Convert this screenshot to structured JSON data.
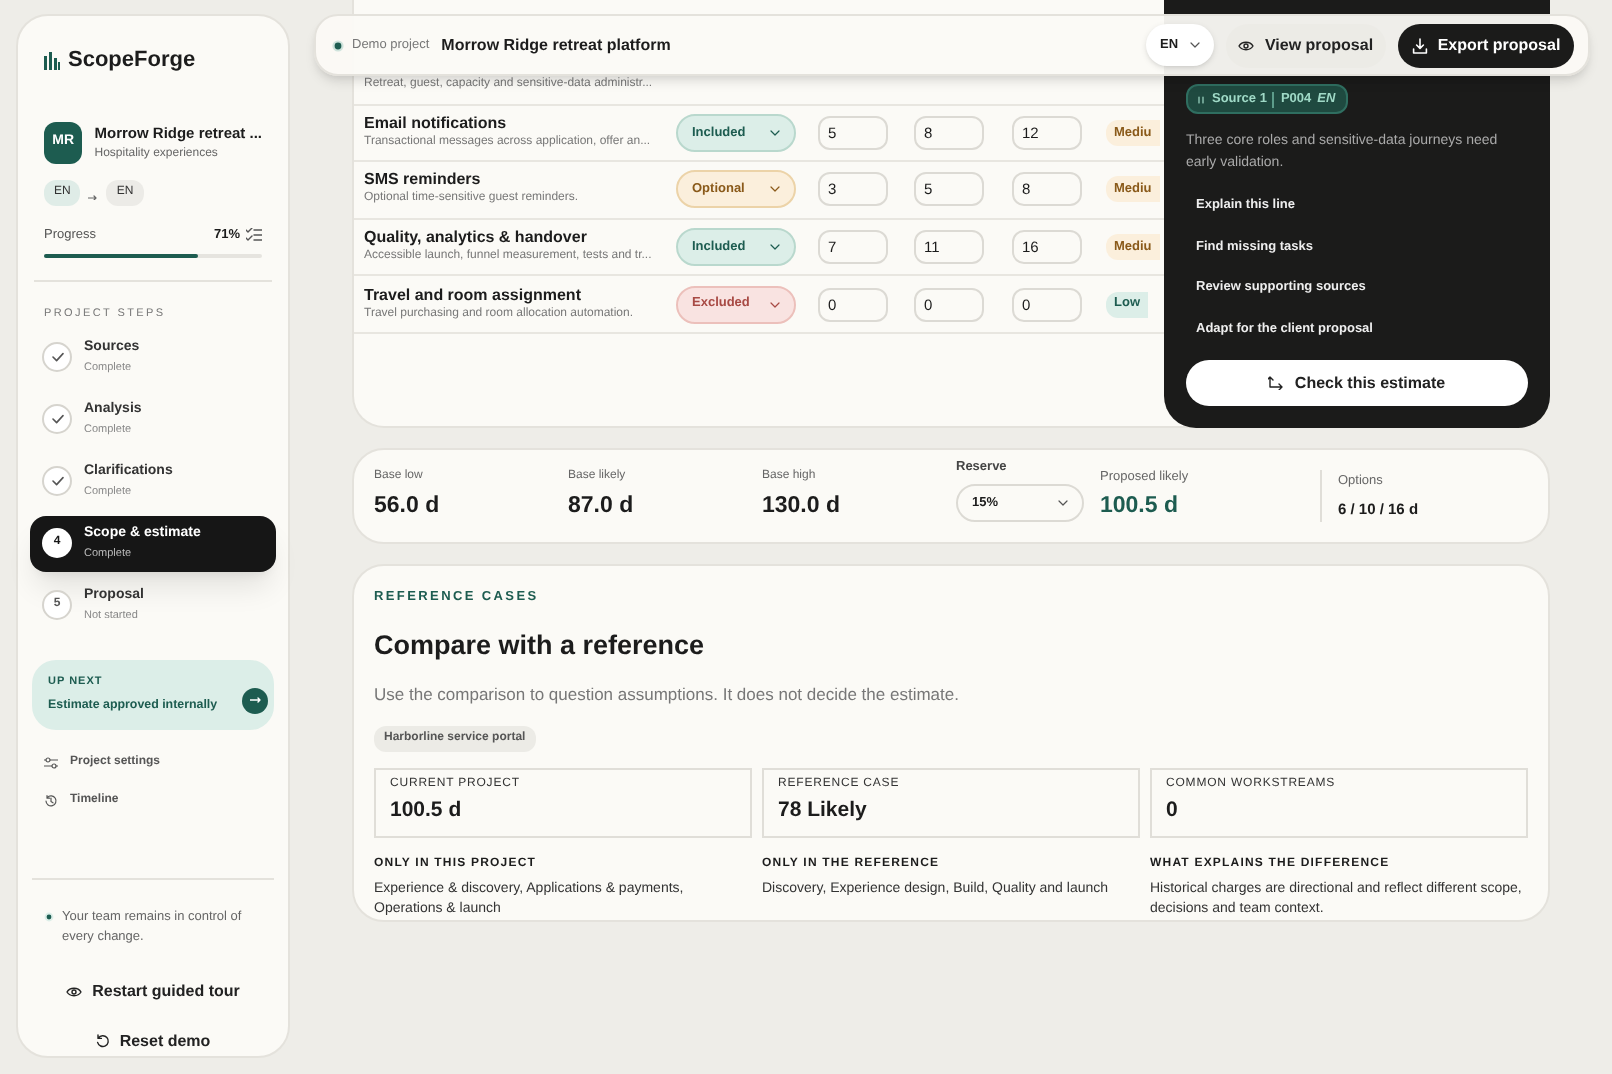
{
  "sidebar": {
    "brand": "ScopeForge",
    "project": {
      "initials": "MR",
      "name": "Morrow Ridge retreat ...",
      "subtitle": "Hospitality experiences"
    },
    "languages": {
      "source": "EN",
      "target": "EN"
    },
    "progress": {
      "label": "Progress",
      "value": "71%",
      "level": 0.71
    },
    "steps_heading": "PROJECT STEPS",
    "steps": [
      {
        "kind": "done",
        "title": "Sources",
        "status": "Complete",
        "selected": false
      },
      {
        "kind": "done",
        "title": "Analysis",
        "status": "Complete",
        "selected": false
      },
      {
        "kind": "done",
        "title": "Clarifications",
        "status": "Complete",
        "selected": false
      },
      {
        "kind": "numbered",
        "number": "4",
        "title": "Scope & estimate",
        "status": "Complete",
        "selected": true
      },
      {
        "kind": "numbered",
        "number": "5",
        "title": "Proposal",
        "status": "Not started",
        "selected": false
      }
    ],
    "up_next": {
      "label": "UP NEXT",
      "title": "Estimate approved internally"
    },
    "links": [
      {
        "kind": "settings",
        "label": "Project settings"
      },
      {
        "kind": "history",
        "label": "Timeline"
      }
    ],
    "note": "Your team remains in control of every change.",
    "buttons": [
      {
        "kind": "tour",
        "label": "Restart guided tour"
      },
      {
        "kind": "reset",
        "label": "Reset demo"
      }
    ]
  },
  "header": {
    "badge": "Demo project",
    "title": "Morrow Ridge retreat platform",
    "language": "EN",
    "buttons": [
      {
        "kind": "secondary",
        "label": "View proposal"
      },
      {
        "kind": "primary",
        "label": "Export proposal"
      }
    ]
  },
  "table": {
    "rows": [
      {
        "description": "Retreat, guest, capacity and sensitive-data administr..."
      },
      {
        "name": "Email notifications",
        "description": "Transactional messages across application, offer an...",
        "status": {
          "label": "Included",
          "kind": "included"
        },
        "low": "5",
        "likely": "8",
        "high": "12",
        "risk": {
          "label": "Mediu",
          "kind": "medium"
        }
      },
      {
        "name": "SMS reminders",
        "description": "Optional time-sensitive guest reminders.",
        "status": {
          "label": "Optional",
          "kind": "optional"
        },
        "low": "3",
        "likely": "5",
        "high": "8",
        "risk": {
          "label": "Mediu",
          "kind": "medium"
        }
      },
      {
        "name": "Quality, analytics & handover",
        "description": "Accessible launch, funnel measurement, tests and tr...",
        "status": {
          "label": "Included",
          "kind": "included"
        },
        "low": "7",
        "likely": "11",
        "high": "16",
        "risk": {
          "label": "Mediu",
          "kind": "medium"
        }
      },
      {
        "name": "Travel and room assignment",
        "description": "Travel purchasing and room allocation automation.",
        "status": {
          "label": "Excluded",
          "kind": "excluded"
        },
        "low": "0",
        "likely": "0",
        "high": "0",
        "risk": {
          "label": "Low",
          "kind": "low"
        }
      }
    ]
  },
  "assistant": {
    "source_chip": {
      "label": "Source 1",
      "ref": "P004",
      "lang": "EN"
    },
    "text": "Three core roles and sensitive-data journeys need early validation.",
    "actions": [
      "Explain this line",
      "Find missing tasks",
      "Review supporting sources",
      "Adapt for the client proposal"
    ],
    "button": "Check this estimate"
  },
  "summary": {
    "metrics": [
      {
        "label": "Base low",
        "value": "56.0 d"
      },
      {
        "label": "Base likely",
        "value": "87.0 d"
      },
      {
        "label": "Base high",
        "value": "130.0 d"
      }
    ],
    "reserve": {
      "label": "Reserve",
      "value": "15%"
    },
    "proposed": {
      "label": "Proposed likely",
      "value": "100.5 d"
    },
    "options": {
      "label": "Options",
      "value": "6 / 10 / 16 d"
    }
  },
  "reference": {
    "eyebrow": "REFERENCE CASES",
    "title": "Compare with a reference",
    "text": "Use the comparison to question assumptions. It does not decide the estimate.",
    "tag": "Harborline service portal",
    "stats": [
      {
        "label": "CURRENT PROJECT",
        "value": "100.5 d"
      },
      {
        "label": "REFERENCE CASE",
        "value": "78 Likely"
      },
      {
        "label": "COMMON WORKSTREAMS",
        "value": "0"
      }
    ],
    "columns": [
      {
        "heading": "ONLY IN THIS PROJECT",
        "text": "Experience & discovery, Applications & payments, Operations & launch"
      },
      {
        "heading": "ONLY IN THE REFERENCE",
        "text": "Discovery, Experience design, Build, Quality and launch"
      },
      {
        "heading": "WHAT EXPLAINS THE DIFFERENCE",
        "text": "Historical charges are directional and reflect different scope, decisions and team context."
      }
    ]
  }
}
